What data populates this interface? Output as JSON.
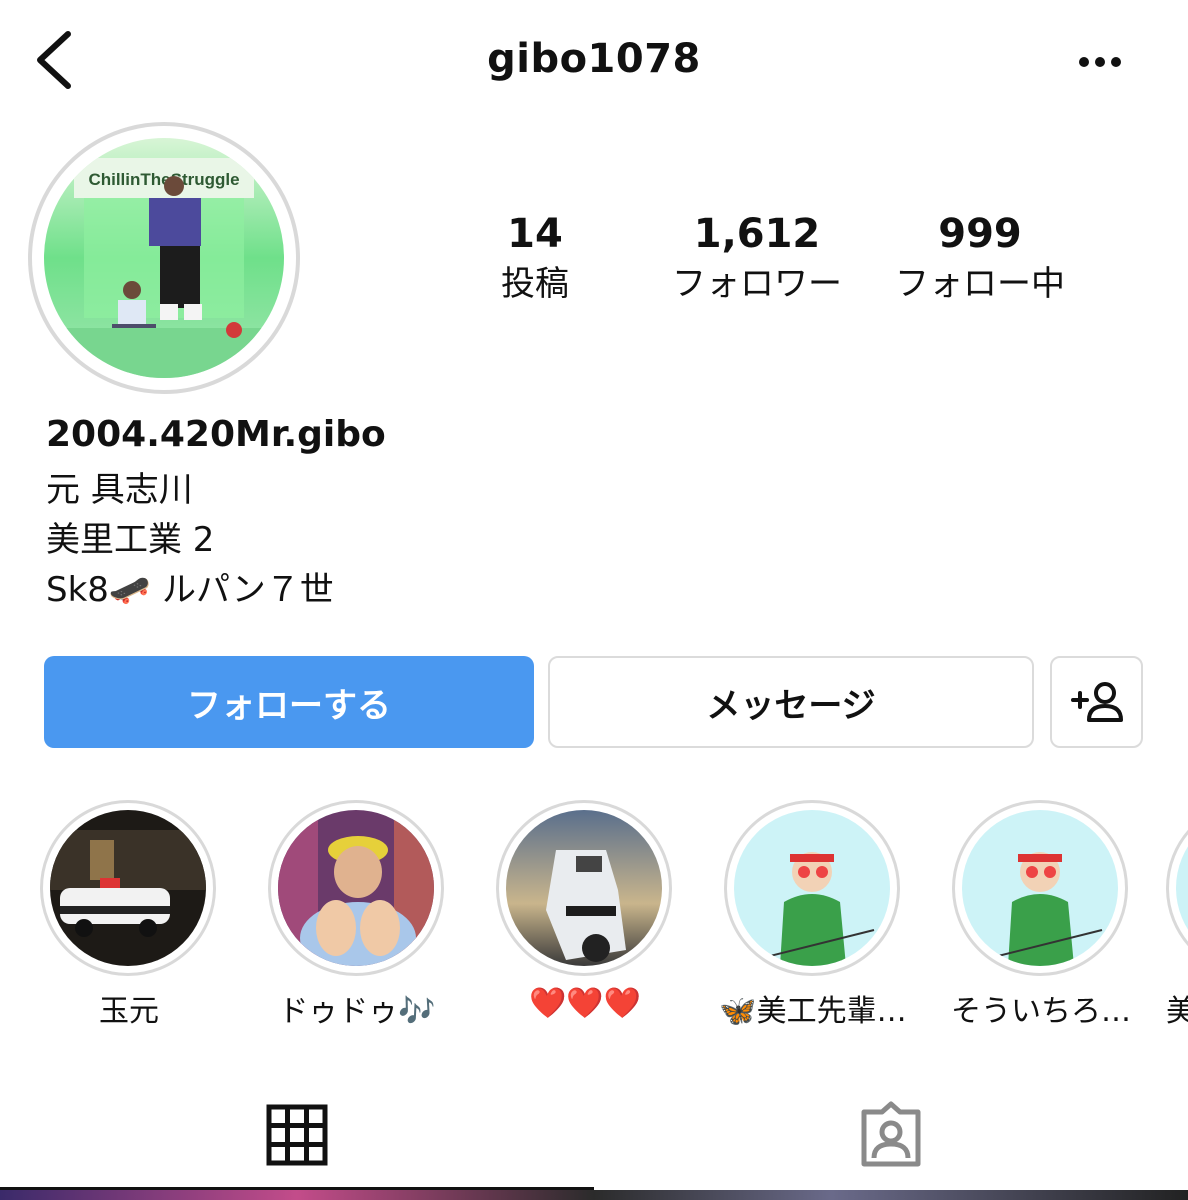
{
  "header": {
    "username": "gibo1078"
  },
  "avatar": {
    "sign_text": "ChillinTheStruggle"
  },
  "stats": [
    {
      "value": "14",
      "label": "投稿"
    },
    {
      "value": "1,612",
      "label": "フォロワー"
    },
    {
      "value": "999",
      "label": "フォロー中"
    }
  ],
  "bio": {
    "name": "2004.420Mr.gibo",
    "lines": [
      "元 具志川",
      "美里工業 2",
      "Sk8🛹 ルパン７世"
    ]
  },
  "actions": {
    "follow_label": "フォローする",
    "message_label": "メッセージ",
    "add_user_icon": "add-user-icon"
  },
  "highlights": [
    {
      "label": "玉元"
    },
    {
      "label": "ドゥドゥ🎶"
    },
    {
      "label": "❤️❤️❤️"
    },
    {
      "label": "🦋美工先輩…"
    },
    {
      "label": "そういちろ…"
    },
    {
      "label": "美"
    }
  ],
  "tabs": {
    "grid_icon": "grid-icon",
    "tagged_icon": "tagged-person-icon"
  },
  "colors": {
    "follow_button": "#4a98f0",
    "border": "#dbdbdb"
  }
}
